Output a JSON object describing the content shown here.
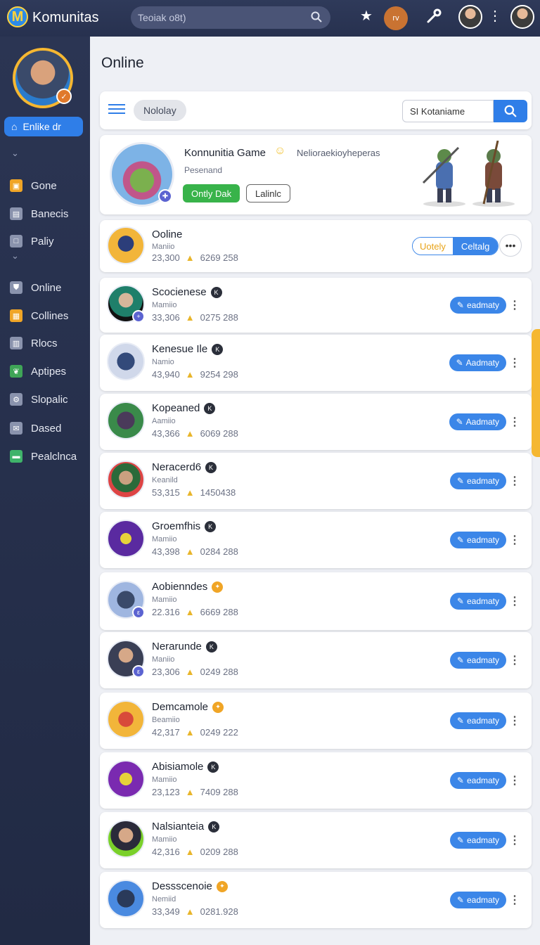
{
  "topbar": {
    "app_title": "Komunitas",
    "search_placeholder": "Teoiak o8t)",
    "badge_label": "rv"
  },
  "sidebar": {
    "active_label": "Enlike dr",
    "items": [
      {
        "label": "Gone",
        "icon": "gamepad-icon",
        "color": "#f0a526"
      },
      {
        "label": "Banecis",
        "icon": "inbox-icon",
        "color": "#8a93ad"
      },
      {
        "label": "Paliy",
        "icon": "square-icon",
        "color": "#8a93ad"
      },
      {
        "label": "Online",
        "icon": "shield-icon",
        "color": "#8a93ad"
      },
      {
        "label": "Collines",
        "icon": "grid-icon",
        "color": "#f0a526"
      },
      {
        "label": "Rlocs",
        "icon": "building-icon",
        "color": "#8a93ad"
      },
      {
        "label": "Aptipes",
        "icon": "leaf-icon",
        "color": "#3fa557"
      },
      {
        "label": "Slopalic",
        "icon": "gear-icon",
        "color": "#8a93ad"
      },
      {
        "label": "Dased",
        "icon": "mail-icon",
        "color": "#8a93ad"
      },
      {
        "label": "Pealclnca",
        "icon": "wallet-icon",
        "color": "#3fb36a"
      }
    ]
  },
  "main": {
    "title": "Online",
    "filter_chip": "Nololay",
    "search_value": "SI Kotaniame"
  },
  "hero": {
    "title": "Konnunitia Game",
    "tagline": "Nelioraekioyheperas",
    "subtitle": "Pesenand",
    "primary_button": "Ontly Dak",
    "secondary_button": "Lalinlc"
  },
  "featured_row": {
    "name": "Ooline",
    "sub": "Maniio",
    "stat1": "23,300",
    "stat2": "6269 258",
    "seg_a": "Uotely",
    "seg_b": "Celtalg"
  },
  "rows": [
    {
      "name": "Scocienese",
      "sub": "Mamiio",
      "stat1": "33,306",
      "stat2": "0275 288",
      "button": "eadmaty",
      "badge": "dark"
    },
    {
      "name": "Kenesue Ile",
      "sub": "Namio",
      "stat1": "43,940",
      "stat2": "9254 298",
      "button": "Aadmaty",
      "badge": "dark"
    },
    {
      "name": "Kopeaned",
      "sub": "Aamiio",
      "stat1": "43,366",
      "stat2": "6069 288",
      "button": "Aadmaty",
      "badge": "dark"
    },
    {
      "name": "Neracerd6",
      "sub": "Keanild",
      "stat1": "53,315",
      "stat2": "1450438",
      "button": "eadmaty",
      "badge": "dark"
    },
    {
      "name": "Groemfhis",
      "sub": "Mamiio",
      "stat1": "43,398",
      "stat2": "0284 288",
      "button": "eadmaty",
      "badge": "dark"
    },
    {
      "name": "Aobienndes",
      "sub": "Mamiio",
      "stat1": "22.316",
      "stat2": "6669 288",
      "button": "eadmaty",
      "badge": "gold"
    },
    {
      "name": "Nerarunde",
      "sub": "Maniio",
      "stat1": "23,306",
      "stat2": "0249 288",
      "button": "eadmaty",
      "badge": "dark"
    },
    {
      "name": "Demcamole",
      "sub": "Beamiio",
      "stat1": "42,317",
      "stat2": "0249 222",
      "button": "eadmaty",
      "badge": "gold"
    },
    {
      "name": "Abisiamole",
      "sub": "Mamiio",
      "stat1": "23,123",
      "stat2": "7409 288",
      "button": "eadmaty",
      "badge": "dark"
    },
    {
      "name": "Nalsianteia",
      "sub": "Mamiio",
      "stat1": "42,316",
      "stat2": "0209 288",
      "button": "eadmaty",
      "badge": "dark"
    },
    {
      "name": "Dessscenoie",
      "sub": "Nemiid",
      "stat1": "33,349",
      "stat2": "0281.928",
      "button": "eadmaty",
      "badge": "gold"
    }
  ],
  "colors": {
    "accent": "#2f7ee8",
    "sidebar_bg": "#252e4a",
    "highlight": "#f5b731",
    "success": "#38b34a"
  }
}
